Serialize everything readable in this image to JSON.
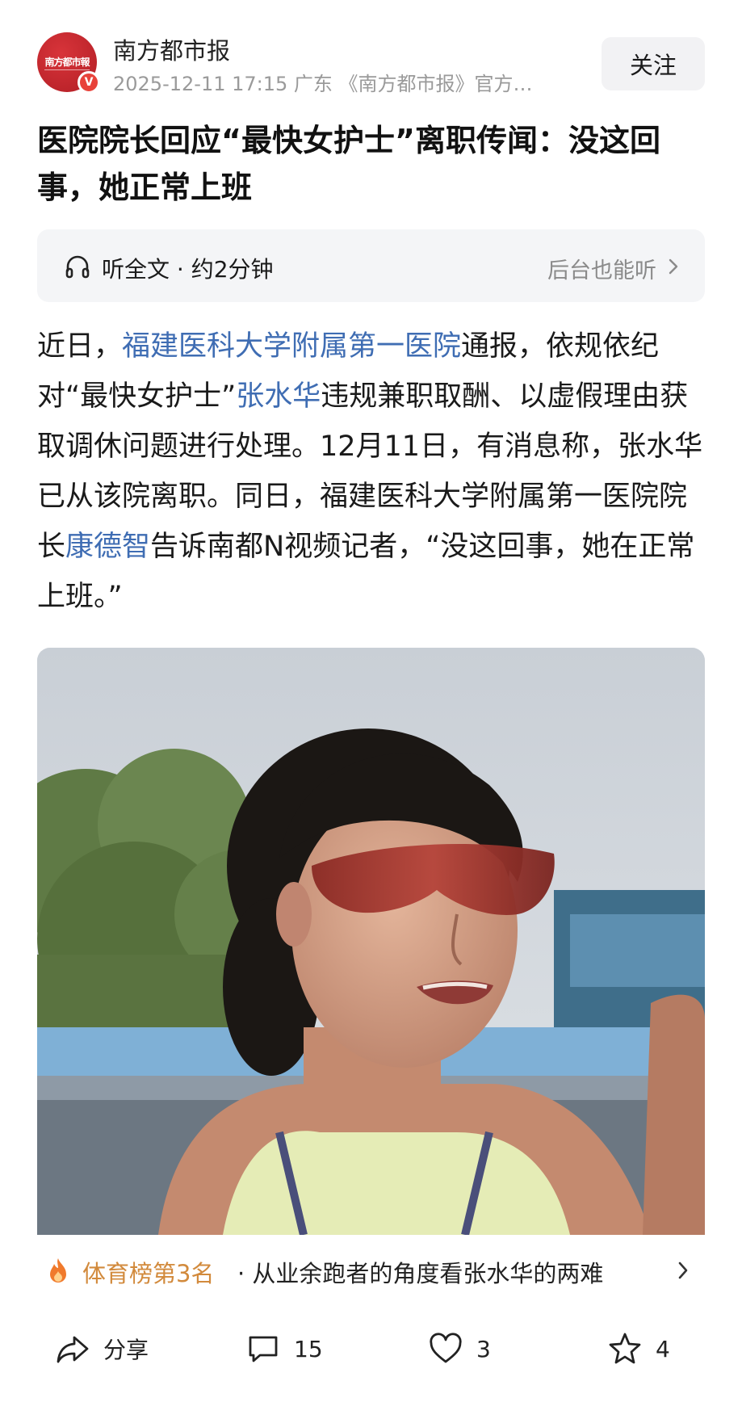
{
  "header": {
    "author": "南方都市报",
    "avatar_text": "南方都市報",
    "verified_badge": "V",
    "meta": "2025-12-11 17:15  广东  《南方都市报》官方…",
    "follow_label": "关注"
  },
  "title": "医院院长回应“最快女护士”离职传闻：没这回事，她正常上班",
  "listen": {
    "label": "听全文 · 约2分钟",
    "right_label": "后台也能听"
  },
  "body": {
    "p1": "近日，",
    "link1": "福建医科大学附属第一医院",
    "p2": "通报，依规依纪对“最快女护士”",
    "link2": "张水华",
    "p3": "违规兼职取酬、以虚假理由获取调休问题进行处理。12月11日，有消息称，张水华已从该院离职。同日，福建医科大学附属第一医院院长",
    "link3": "康德智",
    "p4": "告诉南都N视频记者，“没这回事，她在正常上班。”"
  },
  "trending": {
    "rank": "体育榜第3名",
    "text": "· 从业余跑者的角度看张水华的两难"
  },
  "actions": {
    "share": "分享",
    "comments": "15",
    "likes": "3",
    "favorites": "4"
  },
  "colors": {
    "link": "#3f6db3",
    "rank": "#d28a3c",
    "avatar": "#c8262d"
  }
}
